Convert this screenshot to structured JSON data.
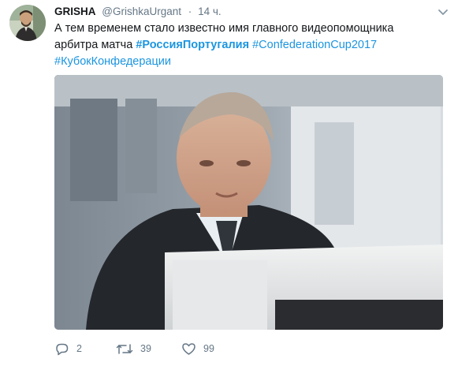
{
  "tweet": {
    "display_name": "GRISHA",
    "handle": "@GrishkaUrgant",
    "separator": "·",
    "time": "14 ч.",
    "text_lines": {
      "line1": "А тем временем стало известно имя главного видеопомощника",
      "line2_prefix": "арбитра матча ",
      "hashtag1": "#РоссияПортугалия",
      "hashtag2": "#ConfederationCup2017",
      "hashtag3": "#КубокКонфедерации"
    },
    "actions": {
      "reply_count": "2",
      "retweet_count": "39",
      "like_count": "99"
    }
  },
  "colors": {
    "link": "#1b95e0",
    "muted": "#657786",
    "text": "#14171a"
  },
  "icons": {
    "caret": "chevron-down-icon",
    "reply": "reply-icon",
    "retweet": "retweet-icon",
    "like": "heart-icon"
  }
}
